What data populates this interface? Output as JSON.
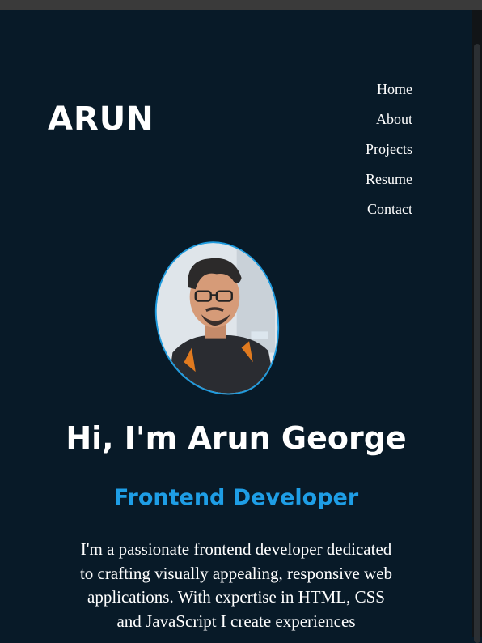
{
  "header": {
    "logo": "ARUN",
    "nav": [
      "Home",
      "About",
      "Projects",
      "Resume",
      "Contact"
    ]
  },
  "hero": {
    "title": "Hi, I'm Arun George",
    "role": "Frontend Developer",
    "description": "I'm a passionate frontend developer dedicated to crafting visually appealing, responsive web applications. With expertise in HTML, CSS and JavaScript I create experiences"
  },
  "colors": {
    "background": "#081a28",
    "accent": "#1e9ee6",
    "text": "#ffffff"
  }
}
